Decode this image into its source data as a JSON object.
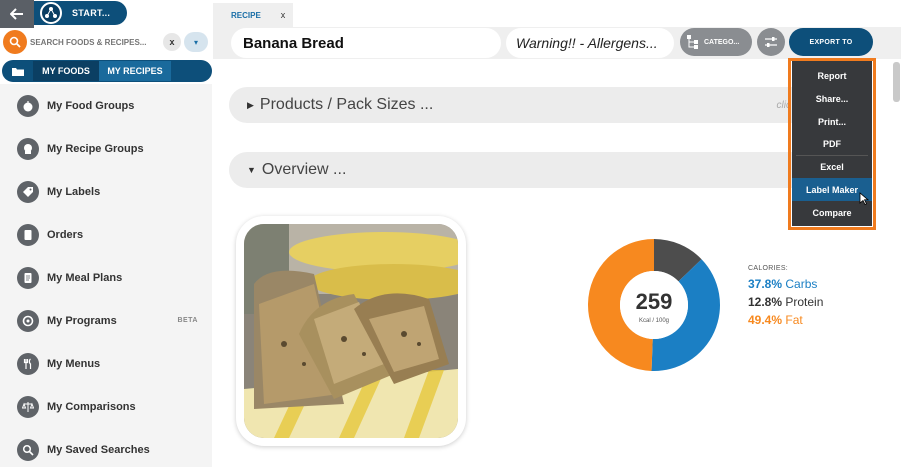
{
  "topbar": {
    "start_label": "START..."
  },
  "search": {
    "placeholder": "SEARCH FOODS & RECIPES...",
    "clear_label": "x",
    "dropdown_label": "▾"
  },
  "sidebar_tabs": {
    "my_foods": "MY FOODS",
    "my_recipes": "MY RECIPES"
  },
  "sidebar": {
    "items": [
      {
        "label": "My Food Groups",
        "icon": "apple-icon"
      },
      {
        "label": "My Recipe Groups",
        "icon": "chef-hat-icon"
      },
      {
        "label": "My Labels",
        "icon": "tag-icon"
      },
      {
        "label": "Orders",
        "icon": "document-icon"
      },
      {
        "label": "My Meal Plans",
        "icon": "meal-plan-icon"
      },
      {
        "label": "My Programs",
        "icon": "programs-icon",
        "badge": "BETA"
      },
      {
        "label": "My Menus",
        "icon": "cutlery-icon"
      },
      {
        "label": "My Comparisons",
        "icon": "scale-icon"
      },
      {
        "label": "My Saved Searches",
        "icon": "search-icon"
      }
    ]
  },
  "doc_tab": {
    "label": "RECIPE",
    "close": "x"
  },
  "toolbar": {
    "title": "Banana Bread",
    "warning": "Warning!! - Allergens...",
    "category_label": "CATEGO...",
    "export_label": "EXPORT TO"
  },
  "sections": {
    "products": {
      "label": "Products / Pack Sizes ...",
      "hint": "clic"
    },
    "overview": {
      "label": "Overview ..."
    }
  },
  "nutrition": {
    "calories": "259",
    "unit": "Kcal / 100g",
    "caption": "CALORIES:",
    "carbs_pct": "37.8%",
    "carbs_label": "Carbs",
    "protein_pct": "12.8%",
    "protein_label": "Protein",
    "fat_pct": "49.4%",
    "fat_label": "Fat",
    "colors": {
      "carbs": "#1b7fc4",
      "protein": "#4d4d4d",
      "fat": "#f7891f"
    }
  },
  "chart_data": {
    "type": "pie",
    "categories": [
      "Carbs",
      "Protein",
      "Fat"
    ],
    "values": [
      37.8,
      12.8,
      49.4
    ],
    "title": "",
    "center_value": "259",
    "center_unit": "Kcal / 100g"
  },
  "export_menu": {
    "items": [
      "Report",
      "Share...",
      "Print...",
      "PDF",
      "Excel",
      "Label Maker",
      "Compare"
    ],
    "highlighted": "Label Maker"
  }
}
